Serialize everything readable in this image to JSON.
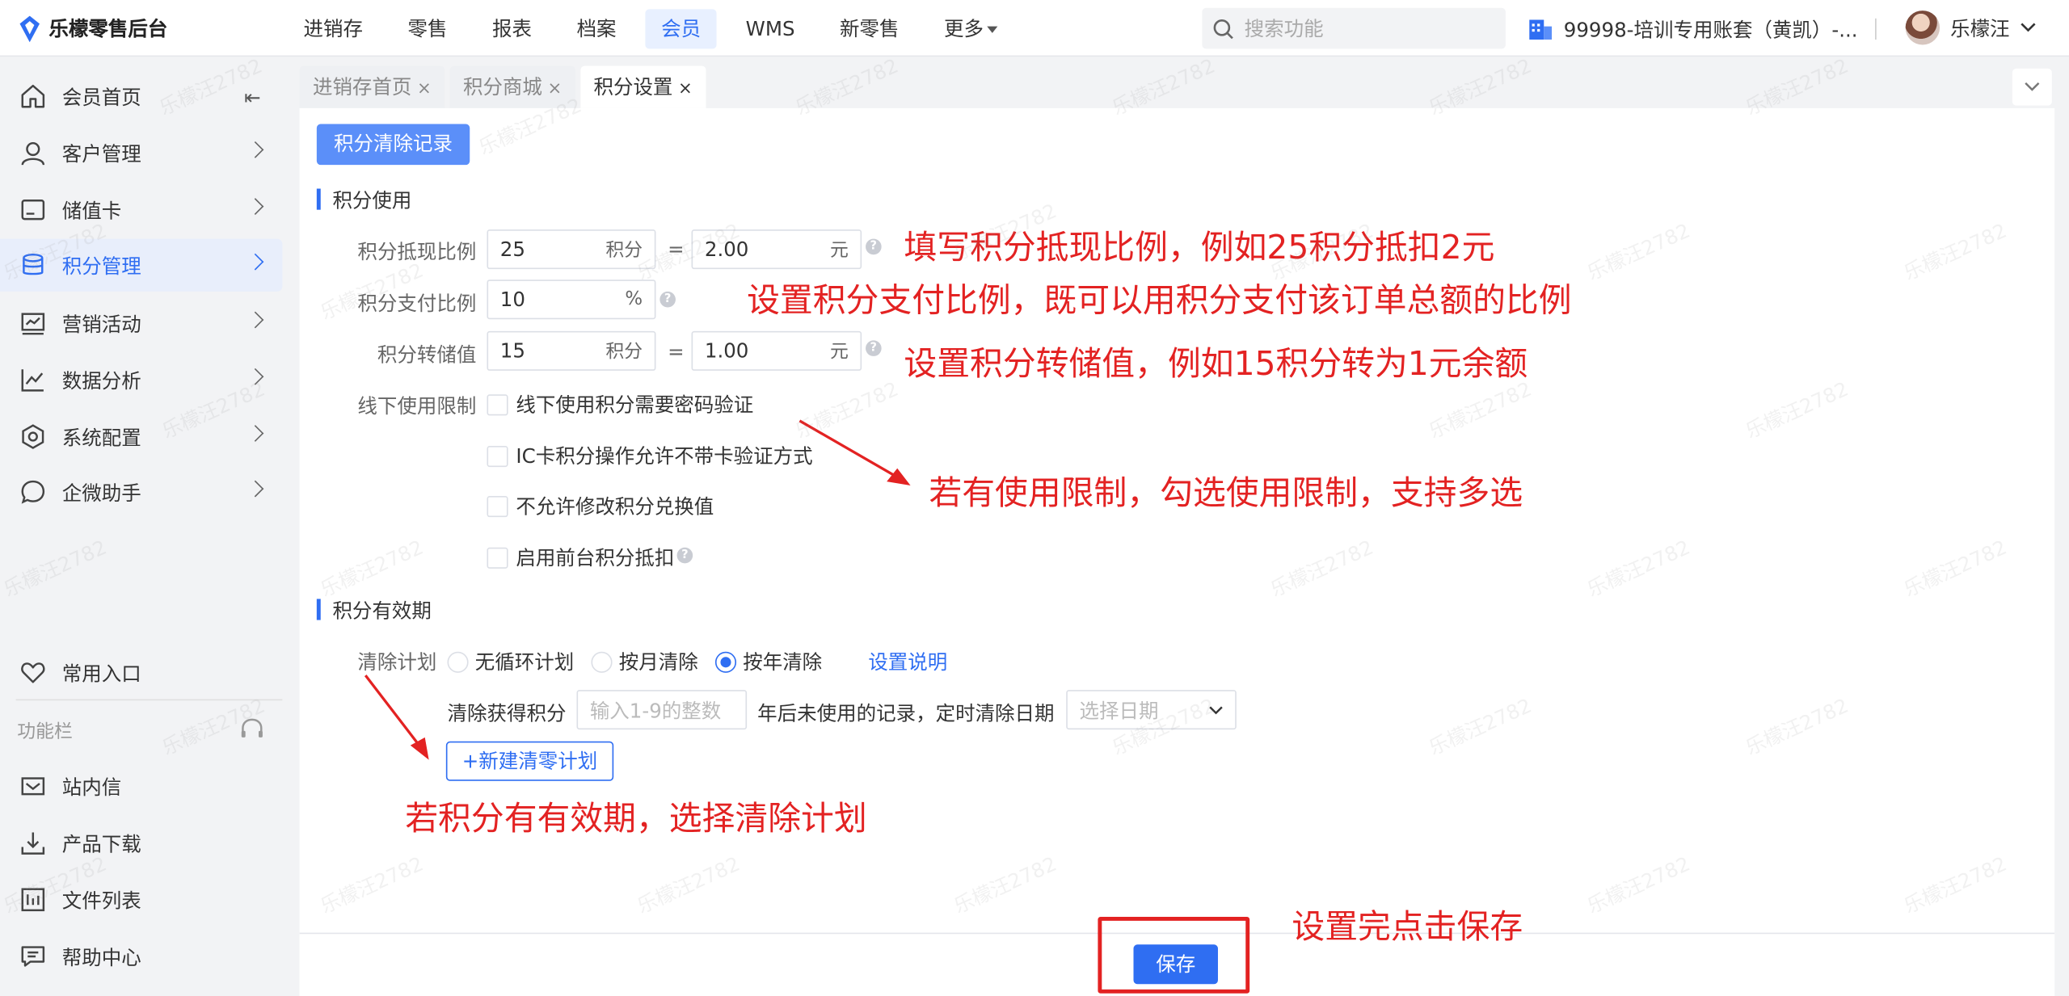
{
  "app": {
    "title": "乐檬零售后台"
  },
  "topnav": {
    "items": [
      {
        "label": "进销存"
      },
      {
        "label": "零售"
      },
      {
        "label": "报表"
      },
      {
        "label": "档案"
      },
      {
        "label": "会员",
        "active": true
      },
      {
        "label": "WMS"
      },
      {
        "label": "新零售"
      },
      {
        "label": "更多"
      }
    ]
  },
  "search": {
    "placeholder": "搜索功能"
  },
  "account": {
    "label": "99998-培训专用账套（黄凯）-..."
  },
  "user": {
    "name": "乐檬汪"
  },
  "sidebar": {
    "items": [
      {
        "label": "会员首页",
        "icon": "home-icon"
      },
      {
        "label": "客户管理",
        "icon": "user-icon"
      },
      {
        "label": "储值卡",
        "icon": "card-icon"
      },
      {
        "label": "积分管理",
        "icon": "database-icon",
        "active": true
      },
      {
        "label": "营销活动",
        "icon": "chart-board-icon"
      },
      {
        "label": "数据分析",
        "icon": "line-chart-icon"
      },
      {
        "label": "系统配置",
        "icon": "settings-icon"
      },
      {
        "label": "企微助手",
        "icon": "chat-icon"
      }
    ],
    "common_entry": "常用入口",
    "function_bar_title": "功能栏",
    "bottom_items": [
      {
        "label": "站内信",
        "icon": "mail-icon"
      },
      {
        "label": "产品下载",
        "icon": "download-icon"
      },
      {
        "label": "文件列表",
        "icon": "file-list-icon"
      },
      {
        "label": "帮助中心",
        "icon": "help-center-icon"
      }
    ]
  },
  "tabs": [
    {
      "label": "进销存首页",
      "close": "×"
    },
    {
      "label": "积分商城",
      "close": "×"
    },
    {
      "label": "积分设置",
      "close": "×",
      "active": true
    }
  ],
  "main": {
    "clear_records_button": "积分清除记录",
    "usage_section": {
      "title": "积分使用",
      "cash_ratio": {
        "label": "积分抵现比例",
        "points": "25",
        "points_unit": "积分",
        "eq": "=",
        "yuan": "2.00",
        "yuan_unit": "元"
      },
      "pay_ratio": {
        "label": "积分支付比例",
        "value": "10",
        "unit": "%"
      },
      "stored_value": {
        "label": "积分转储值",
        "points": "15",
        "points_unit": "积分",
        "eq": "=",
        "yuan": "1.00",
        "yuan_unit": "元"
      },
      "offline_limit": {
        "label": "线下使用限制",
        "options": [
          {
            "label": "线下使用积分需要密码验证",
            "checked": false
          },
          {
            "label": "IC卡积分操作允许不带卡验证方式",
            "checked": false
          },
          {
            "label": "不允许修改积分兑换值",
            "checked": false
          },
          {
            "label": "启用前台积分抵扣",
            "checked": false
          }
        ]
      }
    },
    "validity_section": {
      "title": "积分有效期",
      "plan_label": "清除计划",
      "plan_options": [
        {
          "label": "无循环计划",
          "selected": false
        },
        {
          "label": "按月清除",
          "selected": false
        },
        {
          "label": "按年清除",
          "selected": true
        }
      ],
      "settings_link": "设置说明",
      "clear_prefix": "清除获得积分",
      "years_placeholder": "输入1-9的整数",
      "clear_suffix": "年后未使用的记录，定时清除日期",
      "date_placeholder": "选择日期",
      "new_plan_button": "+新建清零计划"
    },
    "save_button": "保存"
  },
  "annotations": {
    "cash_ratio_note": "填写积分抵现比例，例如25积分抵扣2元",
    "pay_ratio_note": "设置积分支付比例，既可以用积分支付该订单总额的比例",
    "stored_value_note": "设置积分转储值，例如15积分转为1元余额",
    "limit_note": "若有使用限制，勾选使用限制，支持多选",
    "validity_note": "若积分有有效期，选择清除计划",
    "save_note": "设置完点击保存",
    "color": "#e32222"
  },
  "watermark": {
    "text": "乐檬汪2782"
  },
  "colors": {
    "accent": "#2f6ef2",
    "primary_light": "#5b8ff9"
  }
}
